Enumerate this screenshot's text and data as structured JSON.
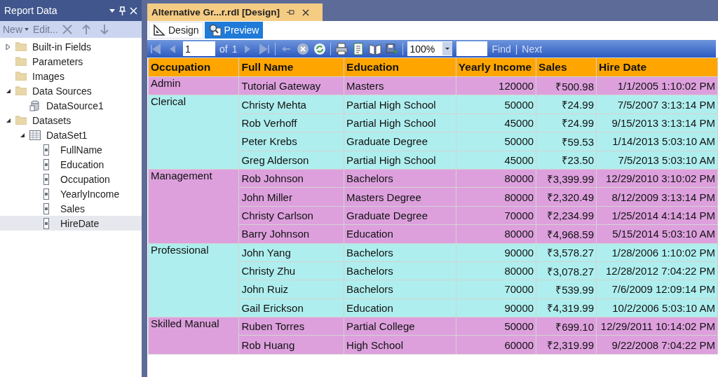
{
  "panel": {
    "title": "Report Data",
    "menu": {
      "new": "New",
      "edit": "Edit..."
    },
    "tree": [
      {
        "label": "Built-in Fields",
        "kind": "folder",
        "expanded": false,
        "selected": false
      },
      {
        "label": "Parameters",
        "kind": "folder",
        "selected": false
      },
      {
        "label": "Images",
        "kind": "folder",
        "selected": false
      },
      {
        "label": "Data Sources",
        "kind": "folder",
        "expanded": true,
        "selected": false,
        "children": [
          {
            "label": "DataSource1",
            "kind": "datasource",
            "selected": false
          }
        ]
      },
      {
        "label": "Datasets",
        "kind": "folder",
        "expanded": true,
        "selected": false,
        "children": [
          {
            "label": "DataSet1",
            "kind": "dataset",
            "expanded": true,
            "selected": false,
            "children": [
              {
                "label": "FullName",
                "kind": "field",
                "selected": false
              },
              {
                "label": "Education",
                "kind": "field",
                "selected": false
              },
              {
                "label": "Occupation",
                "kind": "field",
                "selected": false
              },
              {
                "label": "YearlyIncome",
                "kind": "field",
                "selected": false
              },
              {
                "label": "Sales",
                "kind": "field",
                "selected": false
              },
              {
                "label": "HireDate",
                "kind": "field",
                "selected": true
              }
            ]
          }
        ]
      }
    ]
  },
  "document_tab": {
    "title": "Alternative Gr...r.rdl [Design]"
  },
  "view_tabs": [
    {
      "label": "Design",
      "kind": "design",
      "selected": false
    },
    {
      "label": "Preview",
      "kind": "preview",
      "selected": true
    }
  ],
  "report_toolbar": {
    "page": "1",
    "of": "of",
    "total": "1",
    "zoom": "100%",
    "find": "Find",
    "separator": "|",
    "next": "Next"
  },
  "table": {
    "columns": [
      "Occupation",
      "Full Name",
      "Education",
      "Yearly Income",
      "Sales",
      "Hire Date"
    ],
    "groups": [
      {
        "occupation": "Admin",
        "color": "#dda0dd",
        "rows": [
          [
            "Tutorial Gateway",
            "Masters",
            "120000",
            "₹500.98",
            "1/1/2005 1:10:02 PM"
          ]
        ]
      },
      {
        "occupation": "Clerical",
        "color": "#afeeee",
        "rows": [
          [
            "Christy Mehta",
            "Partial High School",
            "50000",
            "₹24.99",
            "7/5/2007 3:13:14 PM"
          ],
          [
            "Rob Verhoff",
            "Partial High School",
            "45000",
            "₹24.99",
            "9/15/2013 3:13:14 PM"
          ],
          [
            "Peter Krebs",
            "Graduate Degree",
            "50000",
            "₹59.53",
            "1/14/2013 5:03:10 AM"
          ],
          [
            "Greg Alderson",
            "Partial High School",
            "45000",
            "₹23.50",
            "7/5/2013 5:03:10 AM"
          ]
        ]
      },
      {
        "occupation": "Management",
        "color": "#dda0dd",
        "rows": [
          [
            "Rob Johnson",
            "Bachelors",
            "80000",
            "₹3,399.99",
            "12/29/2010 3:10:02 PM"
          ],
          [
            "John Miller",
            "Masters Degree",
            "80000",
            "₹2,320.49",
            "8/12/2009 3:13:14 PM"
          ],
          [
            "Christy Carlson",
            "Graduate Degree",
            "70000",
            "₹2,234.99",
            "1/25/2014 4:14:14 PM"
          ],
          [
            "Barry Johnson",
            "Education",
            "80000",
            "₹4,968.59",
            "5/15/2014 5:03:10 AM"
          ]
        ]
      },
      {
        "occupation": "Professional",
        "color": "#afeeee",
        "rows": [
          [
            "John Yang",
            "Bachelors",
            "90000",
            "₹3,578.27",
            "1/28/2006 1:10:02 PM"
          ],
          [
            "Christy Zhu",
            "Bachelors",
            "80000",
            "₹3,078.27",
            "12/28/2012 7:04:22 PM"
          ],
          [
            "John Ruiz",
            "Bachelors",
            "70000",
            "₹539.99",
            "7/6/2009 12:09:14 PM"
          ],
          [
            "Gail Erickson",
            "Education",
            "90000",
            "₹4,319.99",
            "10/2/2006 5:03:10 AM"
          ]
        ]
      },
      {
        "occupation": "Skilled Manual",
        "color": "#dda0dd",
        "rows": [
          [
            "Ruben Torres",
            "Partial College",
            "50000",
            "₹699.10",
            "12/29/2011 10:14:02 PM"
          ],
          [
            "Rob Huang",
            "High School",
            "60000",
            "₹2,319.99",
            "9/22/2008 7:04:22 PM"
          ]
        ]
      }
    ]
  }
}
